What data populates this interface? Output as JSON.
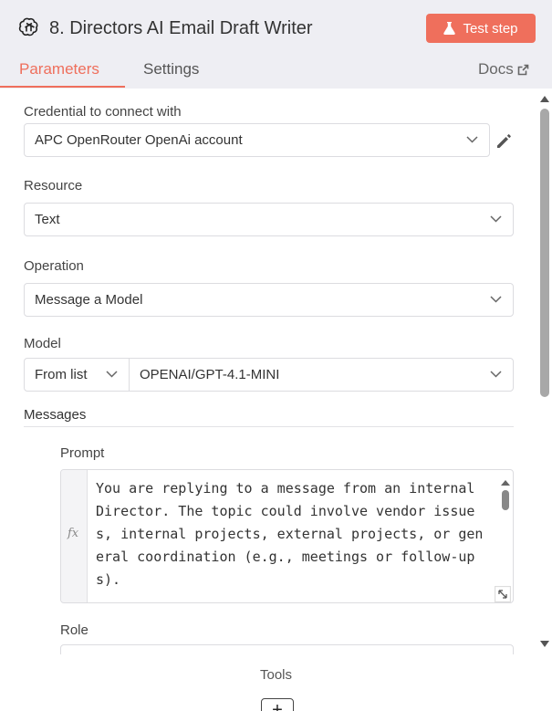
{
  "header": {
    "node_title": "8. Directors AI Email Draft Writer",
    "test_step_label": "Test step",
    "logo_icon": "openai-icon",
    "accent": "#ef6f5c"
  },
  "tabs": {
    "parameters": "Parameters",
    "settings": "Settings",
    "docs": "Docs"
  },
  "form": {
    "credential": {
      "label": "Credential to connect with",
      "value": "APC OpenRouter OpenAi account"
    },
    "resource": {
      "label": "Resource",
      "value": "Text"
    },
    "operation": {
      "label": "Operation",
      "value": "Message a Model"
    },
    "model": {
      "label": "Model",
      "mode": "From list",
      "value": "OPENAI/GPT-4.1-MINI"
    },
    "messages": {
      "label": "Messages",
      "prompt_label": "Prompt",
      "prompt_text": "You are replying to a message from an internal Director. The topic could involve vendor issues, internal projects, external projects, or general coordination (e.g., meetings or follow-ups).\n\nYour response should be friendly, professional",
      "role_label": "Role"
    }
  },
  "footer": {
    "tools_label": "Tools",
    "add_label": "+"
  }
}
